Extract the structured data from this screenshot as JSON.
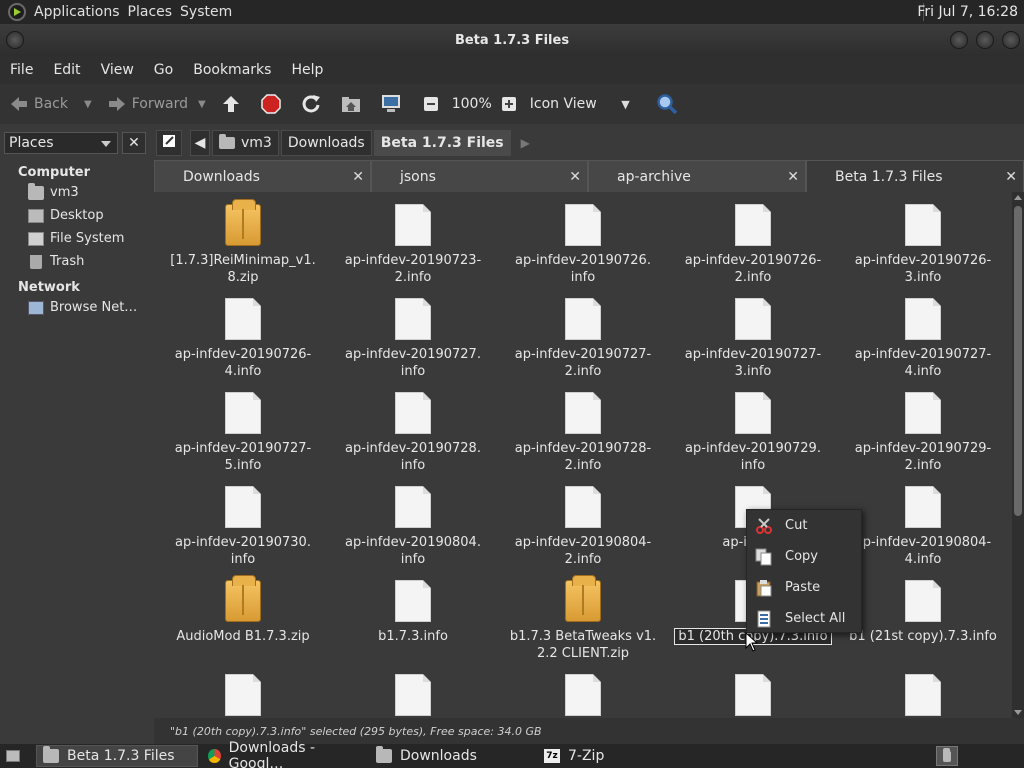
{
  "top_panel": {
    "menus": [
      "Applications",
      "Places",
      "System"
    ],
    "clock": "Fri Jul  7, 16:28"
  },
  "window": {
    "title": "Beta 1.7.3 Files"
  },
  "menubar": [
    "File",
    "Edit",
    "View",
    "Go",
    "Bookmarks",
    "Help"
  ],
  "toolbar": {
    "back": "Back",
    "forward": "Forward",
    "zoom": "100%",
    "view_mode": "Icon View"
  },
  "sidebar": {
    "selector": "Places",
    "computer_heading": "Computer",
    "computer_items": [
      "vm3",
      "Desktop",
      "File System",
      "Trash"
    ],
    "network_heading": "Network",
    "network_items": [
      "Browse Net…"
    ]
  },
  "pathbar": [
    "vm3",
    "Downloads",
    "Beta 1.7.3 Files"
  ],
  "tabs": [
    "Downloads",
    "jsons",
    "ap-archive",
    "Beta 1.7.3 Files"
  ],
  "files": [
    {
      "name": "[1.7.3]ReiMinimap_v1.8.zip",
      "line1": "[1.7.3]ReiMinimap_v1.",
      "line2": "8.zip",
      "type": "zip"
    },
    {
      "name": "ap-infdev-20190723-2.info",
      "line1": "ap-infdev-20190723-",
      "line2": "2.info",
      "type": "doc"
    },
    {
      "name": "ap-infdev-20190726.info",
      "line1": "ap-infdev-20190726.",
      "line2": "info",
      "type": "doc"
    },
    {
      "name": "ap-infdev-20190726-2.info",
      "line1": "ap-infdev-20190726-",
      "line2": "2.info",
      "type": "doc"
    },
    {
      "name": "ap-infdev-20190726-3.info",
      "line1": "ap-infdev-20190726-",
      "line2": "3.info",
      "type": "doc"
    },
    {
      "name": "ap-infdev-20190726-4.info",
      "line1": "ap-infdev-20190726-",
      "line2": "4.info",
      "type": "doc"
    },
    {
      "name": "ap-infdev-20190727.info",
      "line1": "ap-infdev-20190727.",
      "line2": "info",
      "type": "doc"
    },
    {
      "name": "ap-infdev-20190727-2.info",
      "line1": "ap-infdev-20190727-",
      "line2": "2.info",
      "type": "doc"
    },
    {
      "name": "ap-infdev-20190727-3.info",
      "line1": "ap-infdev-20190727-",
      "line2": "3.info",
      "type": "doc"
    },
    {
      "name": "ap-infdev-20190727-4.info",
      "line1": "ap-infdev-20190727-",
      "line2": "4.info",
      "type": "doc"
    },
    {
      "name": "ap-infdev-20190727-5.info",
      "line1": "ap-infdev-20190727-",
      "line2": "5.info",
      "type": "doc"
    },
    {
      "name": "ap-infdev-20190728.info",
      "line1": "ap-infdev-20190728.",
      "line2": "info",
      "type": "doc"
    },
    {
      "name": "ap-infdev-20190728-2.info",
      "line1": "ap-infdev-20190728-",
      "line2": "2.info",
      "type": "doc"
    },
    {
      "name": "ap-infdev-20190729.info",
      "line1": "ap-infdev-20190729.",
      "line2": "info",
      "type": "doc"
    },
    {
      "name": "ap-infdev-20190729-2.info",
      "line1": "ap-infdev-20190729-",
      "line2": "2.info",
      "type": "doc"
    },
    {
      "name": "ap-infdev-20190730.info",
      "line1": "ap-infdev-20190730.",
      "line2": "info",
      "type": "doc"
    },
    {
      "name": "ap-infdev-20190804.info",
      "line1": "ap-infdev-20190804.",
      "line2": "info",
      "type": "doc"
    },
    {
      "name": "ap-infdev-20190804-2.info",
      "line1": "ap-infdev-20190804-",
      "line2": "2.info",
      "type": "doc"
    },
    {
      "name": "ap-infdev-2019...-3.info",
      "line1": "ap-infdev",
      "line2": "3.",
      "type": "doc"
    },
    {
      "name": "ap-infdev-20190804-4.info",
      "line1": "ap-infdev-20190804-",
      "line2": "4.info",
      "type": "doc"
    },
    {
      "name": "AudioMod B1.7.3.zip",
      "line1": "AudioMod B1.7.3.zip",
      "line2": "",
      "type": "zip"
    },
    {
      "name": "b1.7.3.info",
      "line1": "b1.7.3.info",
      "line2": "",
      "type": "doc"
    },
    {
      "name": "b1.7.3 BetaTweaks v1.2.2 CLIENT.zip",
      "line1": "b1.7.3 BetaTweaks v1.",
      "line2": "2.2 CLIENT.zip",
      "type": "zip"
    },
    {
      "name": "b1 (20th copy).7.3.info",
      "line1": "b1 (20th copy).7.3.info",
      "line2": "",
      "type": "doc",
      "selected": true
    },
    {
      "name": "b1 (21st copy).7.3.info",
      "line1": "b1 (21st copy).7.3.info",
      "line2": "",
      "type": "doc"
    },
    {
      "name": "",
      "line1": "",
      "line2": "",
      "type": "doc"
    },
    {
      "name": "",
      "line1": "",
      "line2": "",
      "type": "doc"
    },
    {
      "name": "",
      "line1": "",
      "line2": "",
      "type": "doc"
    },
    {
      "name": "",
      "line1": "",
      "line2": "",
      "type": "doc"
    },
    {
      "name": "",
      "line1": "",
      "line2": "",
      "type": "doc"
    }
  ],
  "context_menu": {
    "items": [
      {
        "label": "Cut",
        "icon": "scissors-icon"
      },
      {
        "label": "Copy",
        "icon": "copy-icon"
      },
      {
        "label": "Paste",
        "icon": "paste-icon"
      },
      {
        "label": "Select All",
        "icon": "select-all-icon"
      }
    ]
  },
  "status": "\"b1 (20th copy).7.3.info\" selected (295 bytes), Free space: 34.0 GB",
  "taskbar": [
    {
      "label": "Beta 1.7.3 Files",
      "active": true,
      "icon": "folder-icon"
    },
    {
      "label": "Downloads - Googl…",
      "active": false,
      "icon": "chrome-icon"
    },
    {
      "label": "Downloads",
      "active": false,
      "icon": "folder-icon"
    },
    {
      "label": "7-Zip",
      "active": false,
      "icon": "7zip-icon"
    }
  ],
  "colors": {
    "panel": "#262626",
    "window_bg": "#3a3a3a",
    "stop_red": "#cc2222",
    "zip_orange": "#e8b14a"
  }
}
